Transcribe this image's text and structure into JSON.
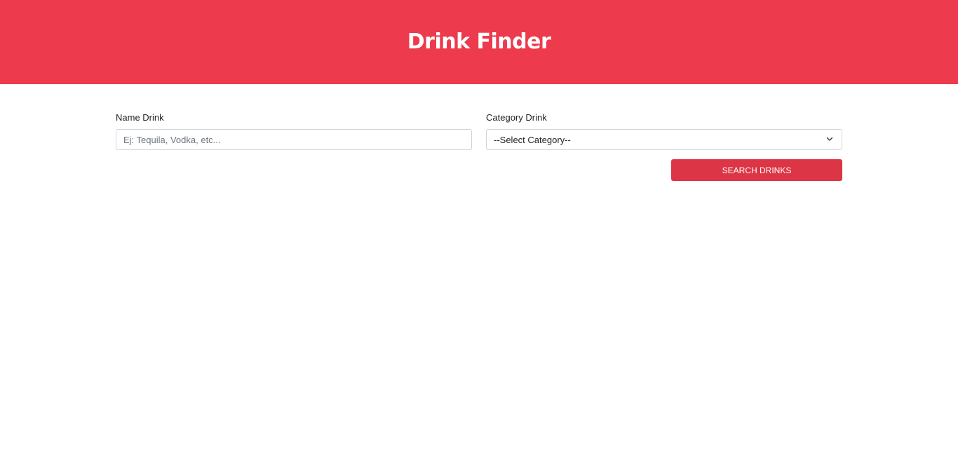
{
  "header": {
    "title": "Drink Finder",
    "background_color": "#ed3a4c"
  },
  "form": {
    "name_field": {
      "label": "Name Drink",
      "placeholder": "Ej: Tequila, Vodka, etc...",
      "value": ""
    },
    "category_field": {
      "label": "Category Drink",
      "selected": "--Select Category--",
      "icon": "chevron-down-icon"
    },
    "submit": {
      "label": "SEARCH DRINKS",
      "color": "#dc3545"
    }
  }
}
